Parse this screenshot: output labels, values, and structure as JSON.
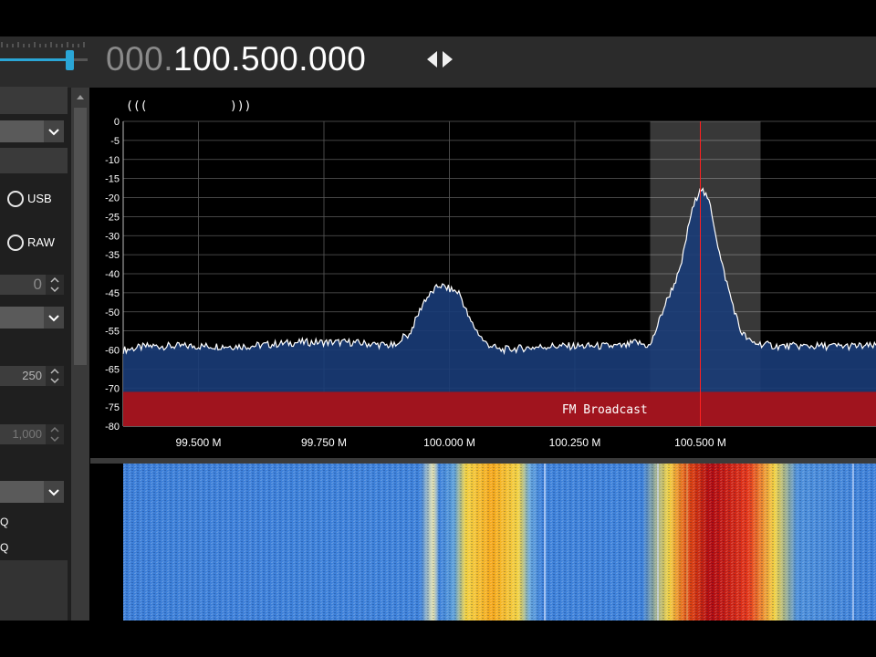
{
  "header": {
    "frequency_prefix": "000.",
    "frequency_main": "100.500.000",
    "arrows_icon": "left-right-arrows-icon"
  },
  "sidebar": {
    "modes": [
      {
        "label": "USB",
        "checked": false
      },
      {
        "label": "RAW",
        "checked": false
      }
    ],
    "spin1_value": "0",
    "spin2_value": "250",
    "spin3_value": "1,000",
    "labels": [
      "Q",
      "Q"
    ]
  },
  "spectrum": {
    "zoom_icons": [
      "(((",
      ")))"
    ],
    "band_label": "FM Broadcast",
    "band_color": "#a0141e",
    "trace_fill_color": "#1a3c78",
    "center_line_color": "#ff2020"
  },
  "chart_data": {
    "type": "line",
    "title": "",
    "xlabel": "",
    "ylabel": "",
    "xlim": [
      99.35,
      100.85
    ],
    "ylim": [
      -80,
      0
    ],
    "grid": true,
    "x_ticks": [
      99.5,
      99.75,
      100.0,
      100.25,
      100.5
    ],
    "x_tick_labels": [
      "99.500 M",
      "99.750 M",
      "100.000 M",
      "100.250 M",
      "100.500 M"
    ],
    "y_ticks": [
      0,
      -5,
      -10,
      -15,
      -20,
      -25,
      -30,
      -35,
      -40,
      -45,
      -50,
      -55,
      -60,
      -65,
      -70,
      -75,
      -80
    ],
    "y_tick_labels": [
      "0",
      "-5",
      "-10",
      "-15",
      "-20",
      "-25",
      "-30",
      "-35",
      "-40",
      "-45",
      "-50",
      "-55",
      "-60",
      "-65",
      "-70",
      "-75",
      "-80"
    ],
    "series": [
      {
        "x": [
          99.35,
          99.4,
          99.5,
          99.6,
          99.7,
          99.8,
          99.9,
          99.88,
          99.9,
          99.92,
          99.95,
          99.98,
          100.0,
          100.02,
          100.04,
          100.07,
          100.1,
          100.2,
          100.3,
          100.35,
          100.37,
          100.4,
          100.43,
          100.46,
          100.48,
          100.5,
          100.52,
          100.54,
          100.56,
          100.58,
          100.6,
          100.65,
          100.7,
          100.85
        ],
        "y": [
          -60,
          -59,
          -59,
          -59,
          -58,
          -58,
          -59,
          -53,
          -57,
          -56,
          -47,
          -43,
          -44,
          -45,
          -52,
          -58,
          -60,
          -59,
          -59,
          -59,
          -58,
          -59,
          -48,
          -39,
          -25,
          -17,
          -22,
          -36,
          -46,
          -55,
          -58,
          -59,
          -59,
          -59
        ]
      }
    ],
    "band": {
      "x0": 100.4,
      "x1": 100.62
    },
    "marker_x": 100.5,
    "bandplan": {
      "label": "FM Broadcast",
      "x0": 99.35,
      "x1": 100.85,
      "y0": -71,
      "y1": -80
    }
  }
}
